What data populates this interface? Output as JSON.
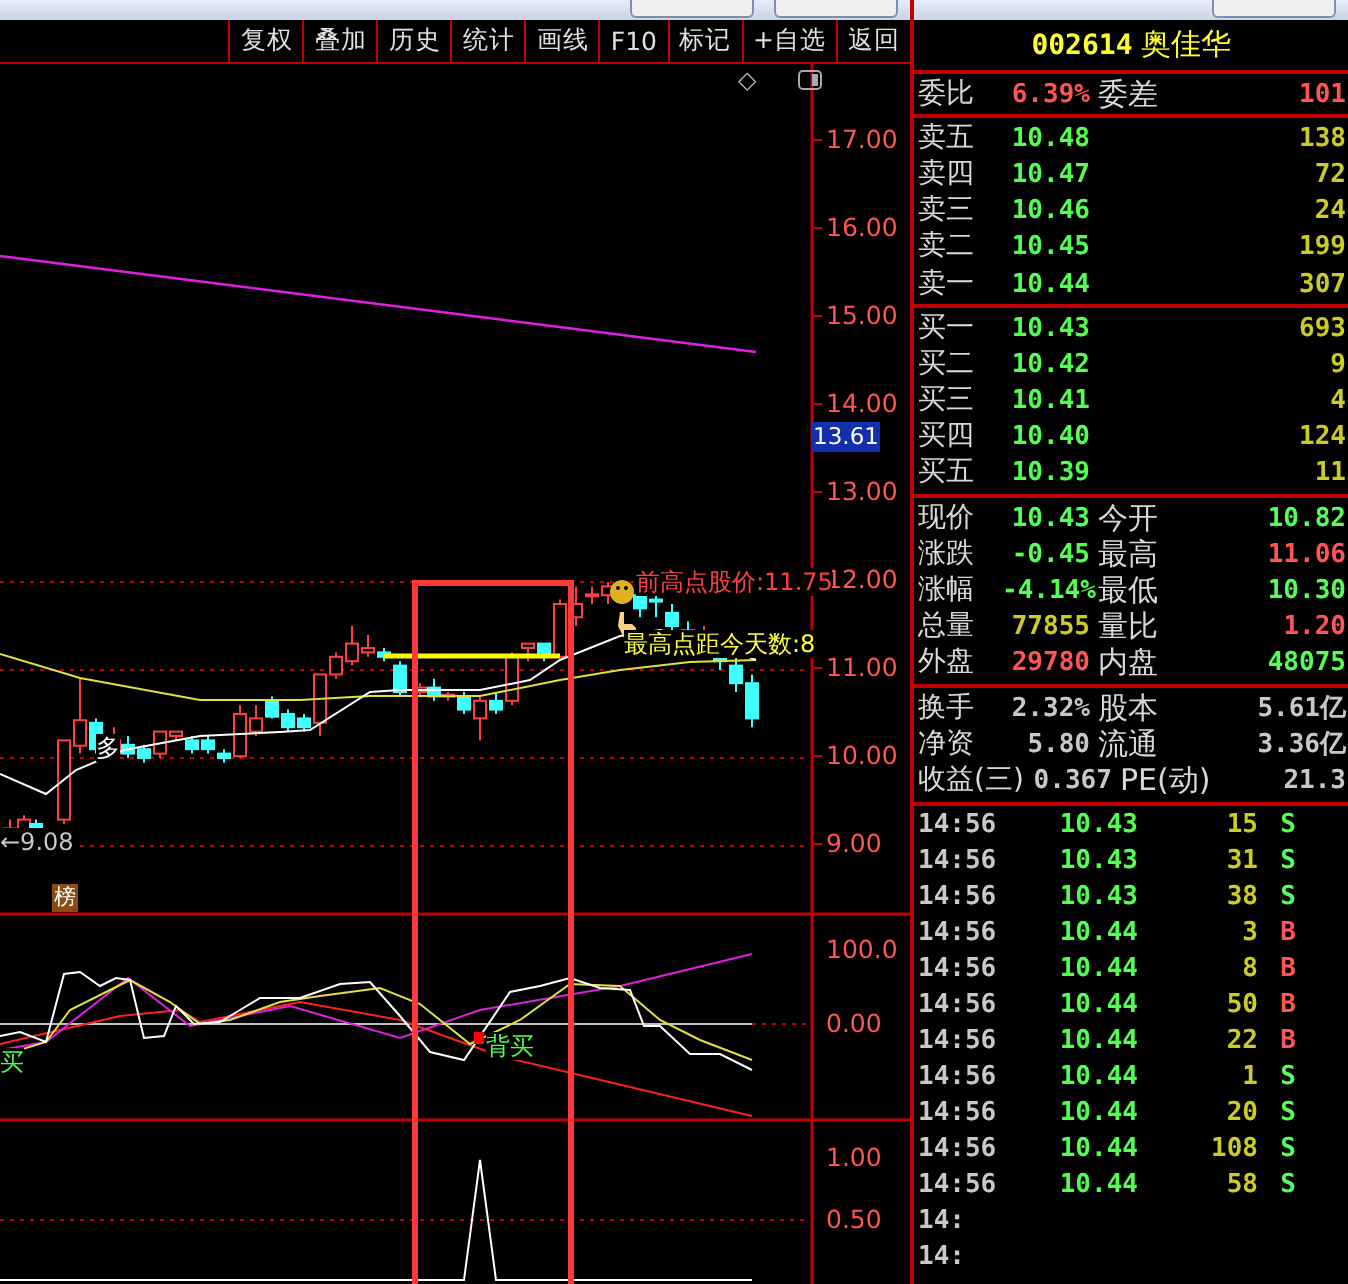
{
  "toolbar": [
    "复权",
    "叠加",
    "历史",
    "统计",
    "画线",
    "F10",
    "标记",
    "+自选",
    "返回"
  ],
  "chart": {
    "corner_glyph": "◇",
    "price_ticks": [
      "17.00",
      "16.00",
      "15.00",
      "14.00",
      "13.00",
      "12.00",
      "11.00",
      "10.00",
      "9.00"
    ],
    "current_price": "13.61",
    "prev_high_label": "前高点股价:11.75",
    "days_label": "最高点距今天数:8",
    "low_marker": "←9.08",
    "rank_badge": "榜",
    "duo_label": "多"
  },
  "indicator": {
    "ticks": [
      "100.0",
      "0.00"
    ],
    "signals": [
      "买",
      "背买"
    ]
  },
  "lower_indicator": {
    "ticks": [
      "1.00",
      "0.50"
    ]
  },
  "stock": {
    "code": "002614",
    "name": "奥佳华"
  },
  "order_ratio": {
    "label": "委比",
    "value": "6.39%",
    "label2": "委差",
    "value2": "101"
  },
  "asks": [
    {
      "label": "卖五",
      "price": "10.48",
      "volume": "138"
    },
    {
      "label": "卖四",
      "price": "10.47",
      "volume": "72"
    },
    {
      "label": "卖三",
      "price": "10.46",
      "volume": "24"
    },
    {
      "label": "卖二",
      "price": "10.45",
      "volume": "199"
    },
    {
      "label": "卖一",
      "price": "10.44",
      "volume": "307"
    }
  ],
  "bids": [
    {
      "label": "买一",
      "price": "10.43",
      "volume": "693"
    },
    {
      "label": "买二",
      "price": "10.42",
      "volume": "9"
    },
    {
      "label": "买三",
      "price": "10.41",
      "volume": "4"
    },
    {
      "label": "买四",
      "price": "10.40",
      "volume": "124"
    },
    {
      "label": "买五",
      "price": "10.39",
      "volume": "11"
    }
  ],
  "quote": [
    {
      "cells": [
        {
          "label": "现价",
          "value": "10.43",
          "color": "#55ff55"
        },
        {
          "label": "今开",
          "value": "10.82",
          "color": "#55ff55"
        }
      ]
    },
    {
      "cells": [
        {
          "label": "涨跌",
          "value": "-0.45",
          "color": "#55ff55"
        },
        {
          "label": "最高",
          "value": "11.06",
          "color": "#ff5555"
        }
      ]
    },
    {
      "cells": [
        {
          "label": "涨幅",
          "value": "-4.14%",
          "color": "#55ff55"
        },
        {
          "label": "最低",
          "value": "10.30",
          "color": "#55ff55"
        }
      ]
    },
    {
      "cells": [
        {
          "label": "总量",
          "value": "77855",
          "color": "#cccc22"
        },
        {
          "label": "量比",
          "value": "1.20",
          "color": "#ff5555"
        }
      ]
    },
    {
      "cells": [
        {
          "label": "外盘",
          "value": "29780",
          "color": "#ff5555"
        },
        {
          "label": "内盘",
          "value": "48075",
          "color": "#55ff55"
        }
      ]
    }
  ],
  "fundamentals": [
    {
      "label": "换手",
      "value": "2.32%",
      "label2": "股本",
      "value2": "5.61亿"
    },
    {
      "label": "净资",
      "value": "5.80",
      "label2": "流通",
      "value2": "3.36亿"
    },
    {
      "label": "收益(三)",
      "value": "0.367",
      "label2": "PE(动)",
      "value2": "21.3"
    }
  ],
  "trades": [
    {
      "time": "14:56",
      "price": "10.43",
      "volume": "15",
      "side": "S",
      "color": "#55ff55"
    },
    {
      "time": "14:56",
      "price": "10.43",
      "volume": "31",
      "side": "S",
      "color": "#55ff55"
    },
    {
      "time": "14:56",
      "price": "10.43",
      "volume": "38",
      "side": "S",
      "color": "#55ff55"
    },
    {
      "time": "14:56",
      "price": "10.44",
      "volume": "3",
      "side": "B",
      "color": "#ff5555"
    },
    {
      "time": "14:56",
      "price": "10.44",
      "volume": "8",
      "side": "B",
      "color": "#ff5555"
    },
    {
      "time": "14:56",
      "price": "10.44",
      "volume": "50",
      "side": "B",
      "color": "#ff5555"
    },
    {
      "time": "14:56",
      "price": "10.44",
      "volume": "22",
      "side": "B",
      "color": "#ff5555"
    },
    {
      "time": "14:56",
      "price": "10.44",
      "volume": "1",
      "side": "S",
      "color": "#55ff55"
    },
    {
      "time": "14:56",
      "price": "10.44",
      "volume": "20",
      "side": "S",
      "color": "#55ff55"
    },
    {
      "time": "14:56",
      "price": "10.44",
      "volume": "108",
      "side": "S",
      "color": "#55ff55"
    },
    {
      "time": "14:56",
      "price": "10.44",
      "volume": "58",
      "side": "S",
      "color": "#55ff55"
    },
    {
      "time": "14:"
    },
    {
      "time": "14:"
    }
  ]
}
